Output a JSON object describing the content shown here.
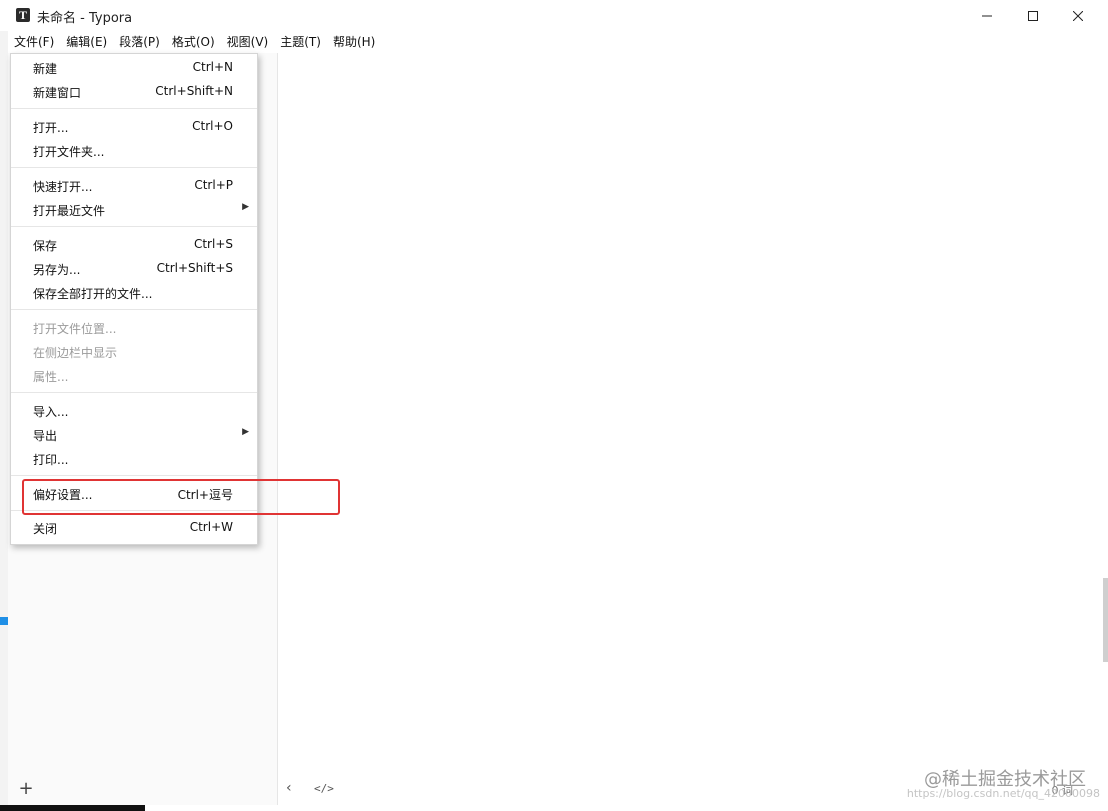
{
  "window": {
    "title": "未命名 - Typora",
    "icon": "typora-icon",
    "controls": [
      "minimize-icon",
      "maximize-icon",
      "close-icon"
    ]
  },
  "menubar": {
    "items": [
      "文件(F)",
      "编辑(E)",
      "段落(P)",
      "格式(O)",
      "视图(V)",
      "主题(T)",
      "帮助(H)"
    ],
    "active": "文件(F)"
  },
  "file_menu": {
    "groups": [
      [
        {
          "label": "新建",
          "shortcut": "Ctrl+N"
        },
        {
          "label": "新建窗口",
          "shortcut": "Ctrl+Shift+N"
        }
      ],
      [
        {
          "label": "打开...",
          "shortcut": "Ctrl+O"
        },
        {
          "label": "打开文件夹...",
          "shortcut": ""
        }
      ],
      [
        {
          "label": "快速打开...",
          "shortcut": "Ctrl+P"
        },
        {
          "label": "打开最近文件",
          "shortcut": "",
          "submenu": true
        }
      ],
      [
        {
          "label": "保存",
          "shortcut": "Ctrl+S"
        },
        {
          "label": "另存为...",
          "shortcut": "Ctrl+Shift+S"
        },
        {
          "label": "保存全部打开的文件...",
          "shortcut": ""
        }
      ],
      [
        {
          "label": "打开文件位置...",
          "shortcut": "",
          "disabled": true
        },
        {
          "label": "在侧边栏中显示",
          "shortcut": "",
          "disabled": true
        },
        {
          "label": "属性...",
          "shortcut": "",
          "disabled": true
        }
      ],
      [
        {
          "label": "导入...",
          "shortcut": ""
        },
        {
          "label": "导出",
          "shortcut": "",
          "submenu": true
        },
        {
          "label": "打印...",
          "shortcut": ""
        }
      ],
      [
        {
          "label": "偏好设置...",
          "shortcut": "Ctrl+逗号",
          "highlighted": true
        }
      ],
      [
        {
          "label": "关闭",
          "shortcut": "Ctrl+W"
        }
      ]
    ]
  },
  "sidebar": {
    "add_icon": "plus-icon"
  },
  "editor_footer": {
    "back_icon": "chevron-left-icon",
    "code_icon": "</>",
    "word_count": "0 词"
  },
  "watermark": {
    "line1": "@稀土掘金技术社区",
    "line2": "https://blog.csdn.net/qq_42000098"
  },
  "colors": {
    "highlight_border": "#e03434",
    "disabled_text": "#9b9b9b",
    "accent": "#1f8fe6"
  }
}
